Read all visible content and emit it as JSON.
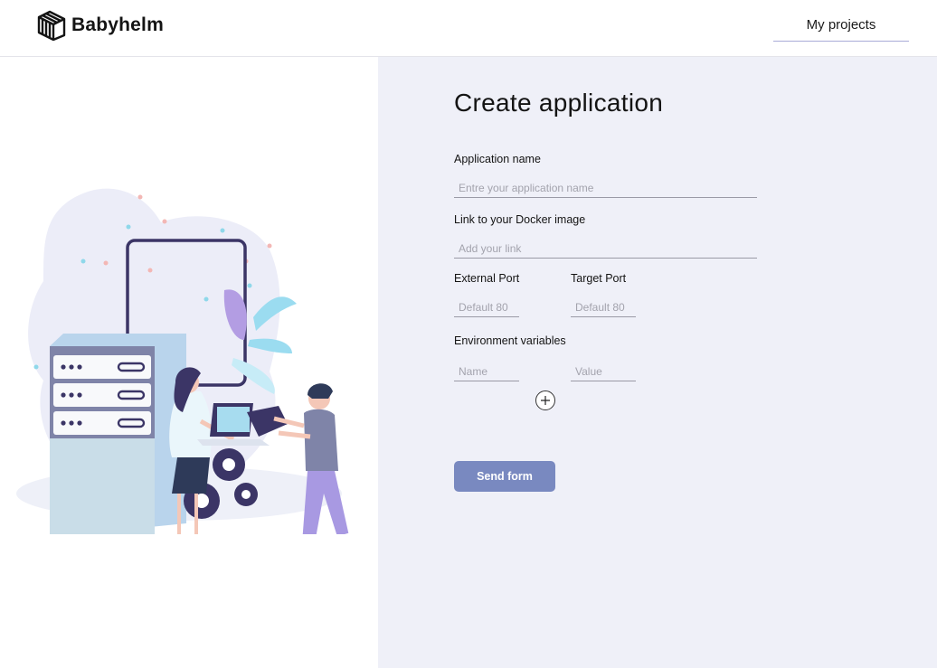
{
  "header": {
    "brand": "Babyhelm",
    "nav_link": "My projects"
  },
  "form": {
    "title": "Create application",
    "app_name": {
      "label": "Application name",
      "placeholder": "Entre your application name",
      "value": ""
    },
    "docker_link": {
      "label": "Link to your Docker image",
      "placeholder": "Add your link",
      "value": ""
    },
    "external_port": {
      "label": "External Port",
      "placeholder": "Default 80",
      "value": ""
    },
    "target_port": {
      "label": "Target Port",
      "placeholder": "Default 80",
      "value": ""
    },
    "env": {
      "label": "Environment variables",
      "name_placeholder": "Name",
      "value_placeholder": "Value"
    },
    "submit_label": "Send form"
  },
  "colors": {
    "accent": "#7989c0",
    "panel_bg": "#eff0f8",
    "nav_underline": "#a9acd8"
  },
  "icons": [
    "babyhelm-logo-icon",
    "plus-icon",
    "server-illustration"
  ]
}
